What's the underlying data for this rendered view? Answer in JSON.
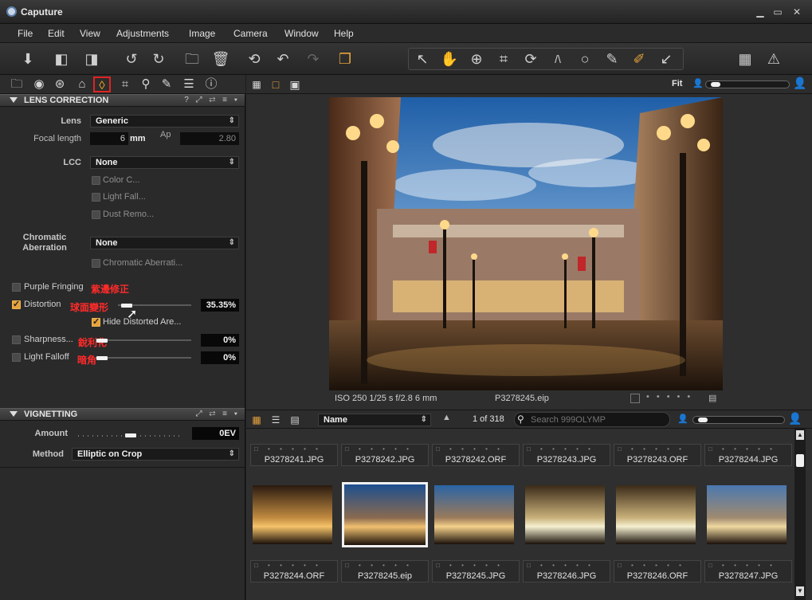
{
  "window": {
    "title": "Caputure"
  },
  "menu": [
    "File",
    "Edit",
    "View",
    "Adjustments",
    "Image",
    "Camera",
    "Window",
    "Help"
  ],
  "lens_panel": {
    "title": "LENS CORRECTION",
    "lens_label": "Lens",
    "lens_value": "Generic",
    "focal_label": "Focal length",
    "focal_value": "6",
    "focal_unit": "mm",
    "ap_label": "Ap",
    "ap_value": "2.80",
    "lcc_label": "LCC",
    "lcc_value": "None",
    "lcc_options": [
      "Color C...",
      "Light Fall...",
      "Dust Remo..."
    ],
    "chromatic_label_1": "Chromatic",
    "chromatic_label_2": "Aberration",
    "chromatic_value": "None",
    "chromatic_option": "Chromatic Aberrati...",
    "purple_fringing": {
      "label": "Purple Fringing",
      "note": "紫邊修正",
      "checked": false
    },
    "distortion": {
      "label": "Distortion",
      "note": "球面變形",
      "value": "35.35%",
      "level": 0.35,
      "checked": true
    },
    "hide_distorted": {
      "label": "Hide Distorted Are...",
      "checked": true
    },
    "sharpness": {
      "label": "Sharpness...",
      "note": "銳利化",
      "value": "0%",
      "level": 0.0,
      "checked": false
    },
    "light_falloff": {
      "label": "Light Falloff",
      "note": "暗角",
      "value": "0%",
      "level": 0.0,
      "checked": false
    }
  },
  "vignetting_panel": {
    "title": "VIGNETTING",
    "amount_label": "Amount",
    "amount_value": "0EV",
    "method_label": "Method",
    "method_value": "Elliptic on Crop"
  },
  "viewer": {
    "fit_label": "Fit",
    "caption_exif": "ISO 250  1/25 s  f/2.8  6 mm",
    "caption_file": "P3278245.eip"
  },
  "browser": {
    "sort_value": "Name",
    "count_text": "1 of 318",
    "search_placeholder": "Search 999OLYMP",
    "row1": [
      "P3278241.JPG",
      "P3278242.JPG",
      "P3278242.ORF",
      "P3278243.JPG",
      "P3278243.ORF",
      "P3278244.JPG"
    ],
    "row2": [
      "P3278244.ORF",
      "P3278245.eip",
      "P3278245.JPG",
      "P3278246.JPG",
      "P3278246.ORF",
      "P3278247.JPG"
    ],
    "selected_index": 1
  },
  "colors": {
    "accent": "#e6a23c",
    "annotation": "#ff2a2a",
    "highlight_box": "#e02424"
  },
  "icons": {
    "toolbar": [
      "import-icon",
      "compare-icon",
      "variant-icon",
      "rotate-left-icon",
      "rotate-right-icon",
      "folder-icon",
      "trash-icon",
      "undo-all-icon",
      "undo-icon",
      "redo-icon",
      "stack-icon"
    ],
    "cursor_tools": [
      "select-icon",
      "hand-icon",
      "zoom-icon",
      "crop-icon",
      "rotate-tool-icon",
      "keystone-icon",
      "circle-icon",
      "brush-icon",
      "picker-icon",
      "arrow-icon"
    ],
    "tool_tabs": [
      "folder-icon",
      "camera-icon",
      "color-icon",
      "exposure-icon",
      "lens-icon",
      "crop-icon",
      "details-icon",
      "local-adjust-icon",
      "metadata-icon",
      "info-icon"
    ]
  }
}
